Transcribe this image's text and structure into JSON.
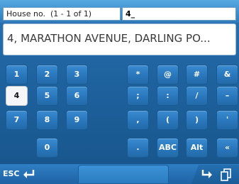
{
  "field": {
    "label": "House no.  (1 - 1 of 1)",
    "value": "4_"
  },
  "result": {
    "text": "4, MARATHON AVENUE, DARLING PO..."
  },
  "keys": {
    "k1": "1",
    "k2": "2",
    "k3": "3",
    "k4": "4",
    "k5": "5",
    "k6": "6",
    "k7": "7",
    "k8": "8",
    "k9": "9",
    "k0": "0",
    "star": "*",
    "at": "@",
    "hash": "#",
    "amp": "&",
    "semicolon": ";",
    "colon": ":",
    "slash": "/",
    "dash": "–",
    "comma": ",",
    "lparen": "(",
    "rparen": ")",
    "apostrophe": "'",
    "period": ".",
    "abc": "ABC",
    "alt": "Alt",
    "quote": "«"
  },
  "selected_key": "4",
  "bottom": {
    "esc_label": "ESC"
  },
  "icons": {
    "esc_arrow": "return-arrow-icon",
    "enter": "enter-arrow-icon",
    "copy": "copy-pages-icon"
  },
  "colors": {
    "background": "#1f639f",
    "key": "#2b78bd",
    "selected_key": "#f4f6f7"
  }
}
